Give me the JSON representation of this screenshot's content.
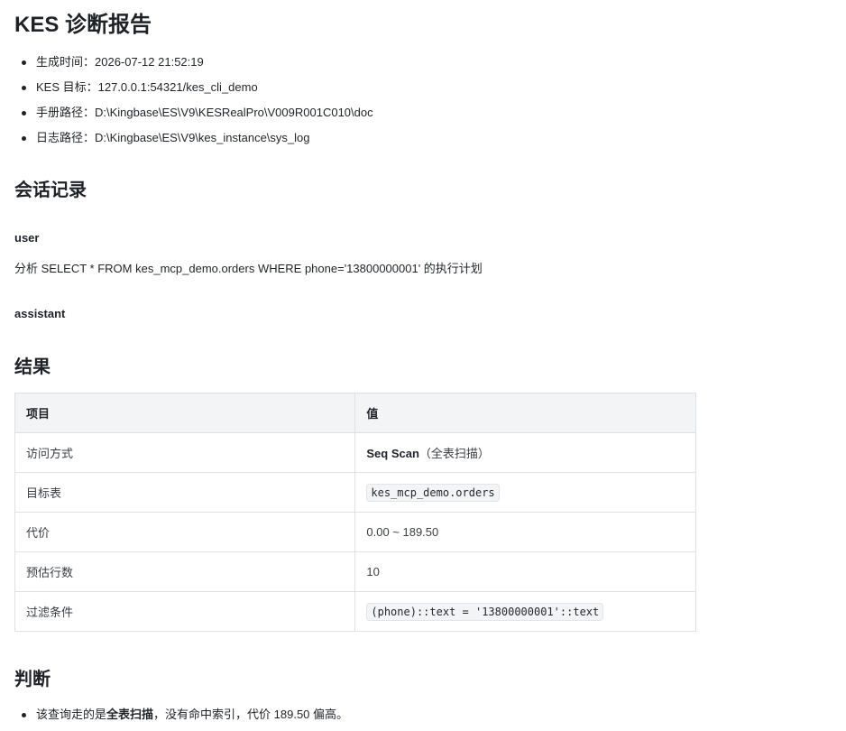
{
  "report": {
    "title": "KES 诊断报告",
    "meta": [
      {
        "label": "生成时间：",
        "value": "2026-07-12 21:52:19"
      },
      {
        "label": "KES 目标：",
        "value": "127.0.0.1:54321/kes_cli_demo"
      },
      {
        "label": "手册路径：",
        "value": "D:\\Kingbase\\ES\\V9\\KESRealPro\\V009R001C010\\doc"
      },
      {
        "label": "日志路径：",
        "value": "D:\\Kingbase\\ES\\V9\\kes_instance\\sys_log"
      }
    ]
  },
  "session": {
    "heading": "会话记录",
    "user_role": "user",
    "user_message": "分析 SELECT * FROM kes_mcp_demo.orders WHERE phone='13800000001' 的执行计划",
    "assistant_role": "assistant"
  },
  "result": {
    "heading": "结果",
    "columns": [
      "项目",
      "值"
    ],
    "rows": [
      {
        "item": "访问方式",
        "value_strong": "Seq Scan",
        "value_rest": "（全表扫描）"
      },
      {
        "item": "目标表",
        "value_code": "kes_mcp_demo.orders"
      },
      {
        "item": "代价",
        "value": "0.00 ~ 189.50"
      },
      {
        "item": "预估行数",
        "value": "10"
      },
      {
        "item": "过滤条件",
        "value_code": "(phone)::text = '13800000001'::text"
      }
    ]
  },
  "judgement": {
    "heading": "判断",
    "line_pre": "该查询走的是",
    "line_strong": "全表扫描",
    "line_post": "，没有命中索引，代价 189.50 偏高。"
  }
}
